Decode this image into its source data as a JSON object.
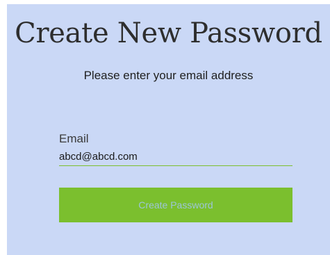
{
  "page": {
    "title": "Create New Password",
    "subtitle": "Please enter your email address"
  },
  "form": {
    "email_label": "Email",
    "email_value": "abcd@abcd.com",
    "submit_label": "Create Password"
  },
  "colors": {
    "panel_background": "#cad8f6",
    "accent": "#7bbf2e",
    "button_text": "#9cc6d8"
  }
}
